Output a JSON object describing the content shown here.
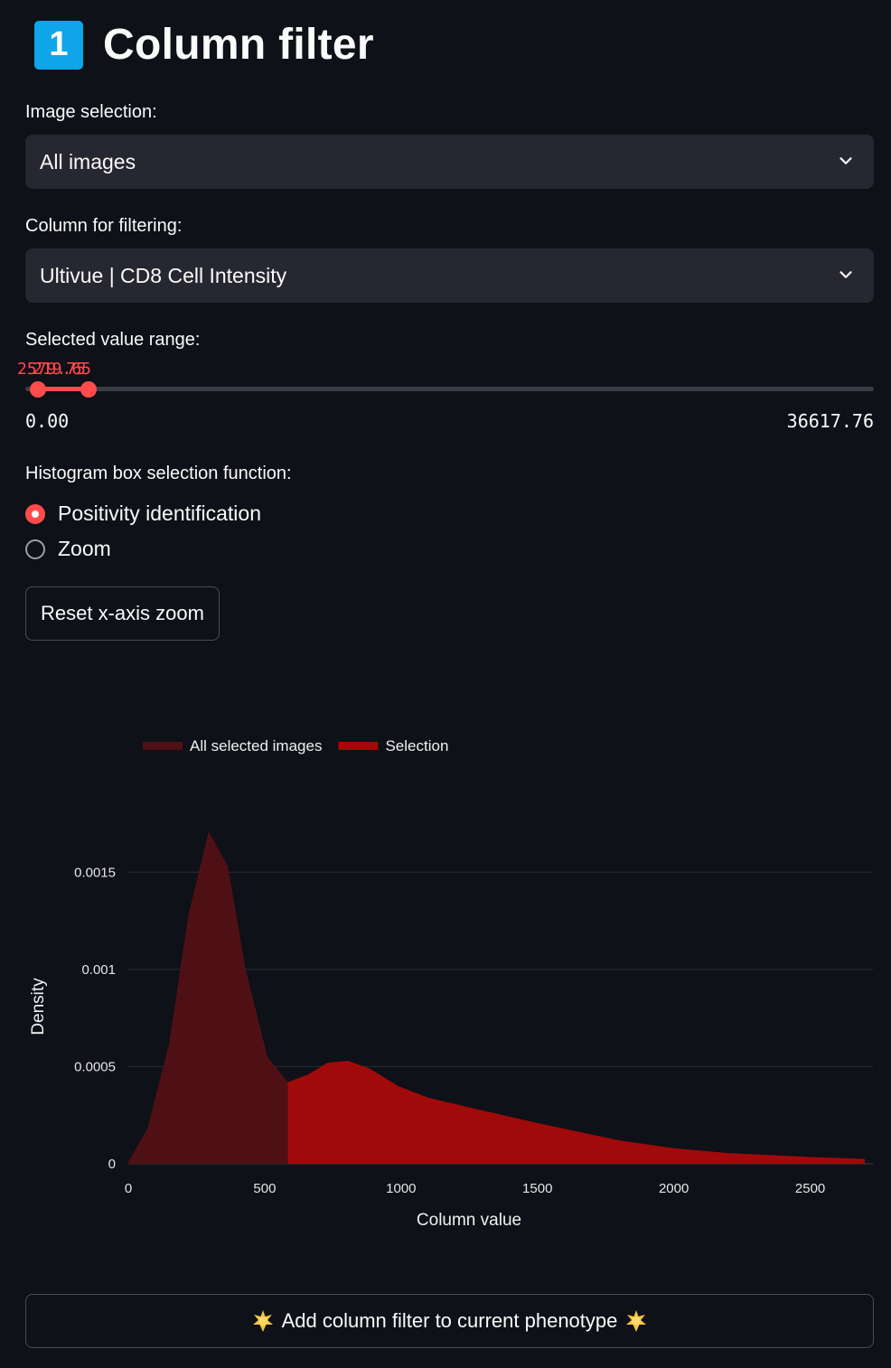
{
  "header": {
    "badge": "1",
    "title": "Column filter"
  },
  "image_selection": {
    "label": "Image selection:",
    "value": "All images"
  },
  "column_selection": {
    "label": "Column for filtering:",
    "value": "Ultivue | CD8 Cell Intensity"
  },
  "range": {
    "label": "Selected value range:",
    "low_value": "219.65",
    "high_value": "2579.75",
    "min": "0.00",
    "max": "36617.76",
    "low_fraction": 0.006,
    "high_fraction": 0.07
  },
  "histogram_function": {
    "label": "Histogram box selection function:",
    "options": [
      {
        "label": "Positivity identification",
        "selected": true
      },
      {
        "label": "Zoom",
        "selected": false
      }
    ]
  },
  "reset_button": "Reset x-axis zoom",
  "add_button": {
    "icon": "sparkle-icon",
    "label": "Add column filter to current phenotype"
  },
  "colors": {
    "accent": "#ff4b4b",
    "all_selected": "#4f1015",
    "selection": "#a00a0a"
  },
  "chart_data": {
    "type": "area",
    "xlabel": "Column value",
    "ylabel": "Density",
    "xlim": [
      0,
      2730
    ],
    "ylim": [
      0,
      0.00185
    ],
    "xticks": [
      "0",
      "500",
      "1000",
      "1500",
      "2000",
      "2500"
    ],
    "yticks": [
      "0",
      "0.0005",
      "0.001",
      "0.0015"
    ],
    "legend_position": "top-left",
    "grid": true,
    "series": [
      {
        "name": "All selected images",
        "color": "#4f1015",
        "x": [
          0,
          70,
          150,
          220,
          295,
          365,
          430,
          510,
          585
        ],
        "y": [
          1e-05,
          0.00018,
          0.00062,
          0.00128,
          0.00171,
          0.00153,
          0.001,
          0.00055,
          0.00042
        ]
      },
      {
        "name": "Selection",
        "color": "#a00a0a",
        "x": [
          585,
          660,
          730,
          805,
          885,
          990,
          1100,
          1250,
          1500,
          1800,
          2000,
          2200,
          2500,
          2700
        ],
        "y": [
          0.00042,
          0.00046,
          0.00052,
          0.00053,
          0.00049,
          0.0004,
          0.00034,
          0.00029,
          0.00021,
          0.00012,
          8e-05,
          5.5e-05,
          3.5e-05,
          2.5e-05
        ]
      }
    ]
  }
}
